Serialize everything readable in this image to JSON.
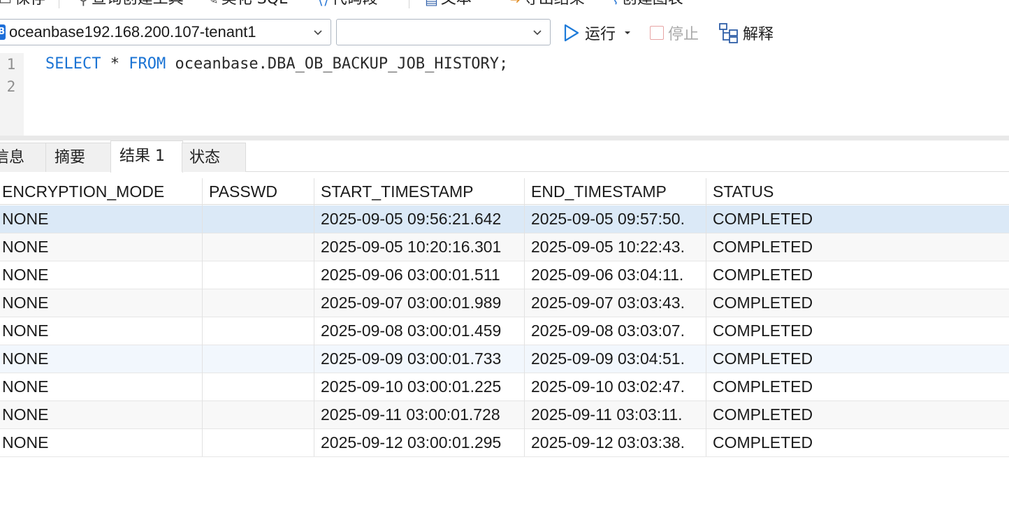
{
  "toolbar": {
    "items": [
      {
        "label": "保存",
        "icon": "save-icon"
      },
      {
        "label": "查询创建工具",
        "icon": "query-builder-icon"
      },
      {
        "label": "美化 SQL",
        "icon": "beautify-icon"
      },
      {
        "label": "代码段",
        "icon": "code-snippet-icon"
      },
      {
        "label": "文本",
        "icon": "text-icon"
      },
      {
        "label": "导出结果",
        "icon": "export-icon"
      },
      {
        "label": "创建图表",
        "icon": "chart-icon"
      }
    ]
  },
  "connection": {
    "selected": "oceanbase192.168.200.107-tenant1",
    "database": ""
  },
  "actions": {
    "run_label": "运行",
    "stop_label": "停止",
    "explain_label": "解释"
  },
  "editor": {
    "lines": [
      {
        "number": "1",
        "keyword1": "SELECT",
        "mid": " * ",
        "keyword2": "FROM",
        "rest": " oceanbase.DBA_OB_BACKUP_JOB_HISTORY;"
      },
      {
        "number": "2"
      }
    ]
  },
  "tabs": [
    {
      "label": "信息",
      "active": false
    },
    {
      "label": "摘要",
      "active": false
    },
    {
      "label": "结果 1",
      "active": true
    },
    {
      "label": "状态",
      "active": false
    }
  ],
  "grid": {
    "columns": [
      "ENCRYPTION_MODE",
      "PASSWD",
      "START_TIMESTAMP",
      "END_TIMESTAMP",
      "STATUS"
    ],
    "rows": [
      [
        "NONE",
        "",
        "2025-09-05 09:56:21.642",
        "2025-09-05 09:57:50.",
        "COMPLETED"
      ],
      [
        "NONE",
        "",
        "2025-09-05 10:20:16.301",
        "2025-09-05 10:22:43.",
        "COMPLETED"
      ],
      [
        "NONE",
        "",
        "2025-09-06 03:00:01.511",
        "2025-09-06 03:04:11.",
        "COMPLETED"
      ],
      [
        "NONE",
        "",
        "2025-09-07 03:00:01.989",
        "2025-09-07 03:03:43.",
        "COMPLETED"
      ],
      [
        "NONE",
        "",
        "2025-09-08 03:00:01.459",
        "2025-09-08 03:03:07.",
        "COMPLETED"
      ],
      [
        "NONE",
        "",
        "2025-09-09 03:00:01.733",
        "2025-09-09 03:04:51.",
        "COMPLETED"
      ],
      [
        "NONE",
        "",
        "2025-09-10 03:00:01.225",
        "2025-09-10 03:02:47.",
        "COMPLETED"
      ],
      [
        "NONE",
        "",
        "2025-09-11 03:00:01.728",
        "2025-09-11 03:03:11.",
        "COMPLETED"
      ],
      [
        "NONE",
        "",
        "2025-09-12 03:00:01.295",
        "2025-09-12 03:03:38.",
        "COMPLETED"
      ]
    ],
    "selected_row": 0
  },
  "colors": {
    "keyword": "#1a73d4",
    "selected_row": "#dbe9f7",
    "accent": "#1e6fd9"
  }
}
